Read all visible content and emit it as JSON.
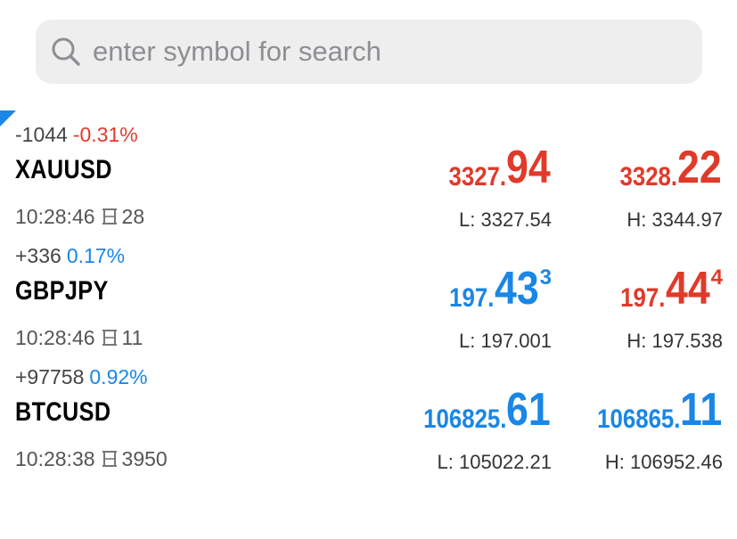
{
  "search": {
    "placeholder": "enter symbol for search"
  },
  "quotes": [
    {
      "change_points": "-1044",
      "change_percent": "-0.31%",
      "direction": "down",
      "symbol": "XAUUSD",
      "time": "10:28:46",
      "spread": "28",
      "bid": {
        "small": "3327.",
        "big": "94",
        "sup": "",
        "color": "red"
      },
      "ask": {
        "small": "3328.",
        "big": "22",
        "sup": "",
        "color": "red"
      },
      "low": "L: 3327.54",
      "high": "H: 3344.97"
    },
    {
      "change_points": "+336",
      "change_percent": "0.17%",
      "direction": "up",
      "symbol": "GBPJPY",
      "time": "10:28:46",
      "spread": "11",
      "bid": {
        "small": "197.",
        "big": "43",
        "sup": "3",
        "color": "blue"
      },
      "ask": {
        "small": "197.",
        "big": "44",
        "sup": "4",
        "color": "red"
      },
      "low": "L: 197.001",
      "high": "H: 197.538"
    },
    {
      "change_points": "+97758",
      "change_percent": "0.92%",
      "direction": "up",
      "symbol": "BTCUSD",
      "time": "10:28:38",
      "spread": "3950",
      "bid": {
        "small": "106825.",
        "big": "61",
        "sup": "",
        "color": "blue"
      },
      "ask": {
        "small": "106865.",
        "big": "11",
        "sup": "",
        "color": "blue"
      },
      "low": "L: 105022.21",
      "high": "H: 106952.46"
    }
  ],
  "colors": {
    "down": "#e03a2a",
    "up": "#1a86e6",
    "search_bg": "#eeeeef"
  },
  "icons": {
    "search": "search-icon",
    "spread": "spread-icon",
    "selection_marker": "corner-marker"
  }
}
